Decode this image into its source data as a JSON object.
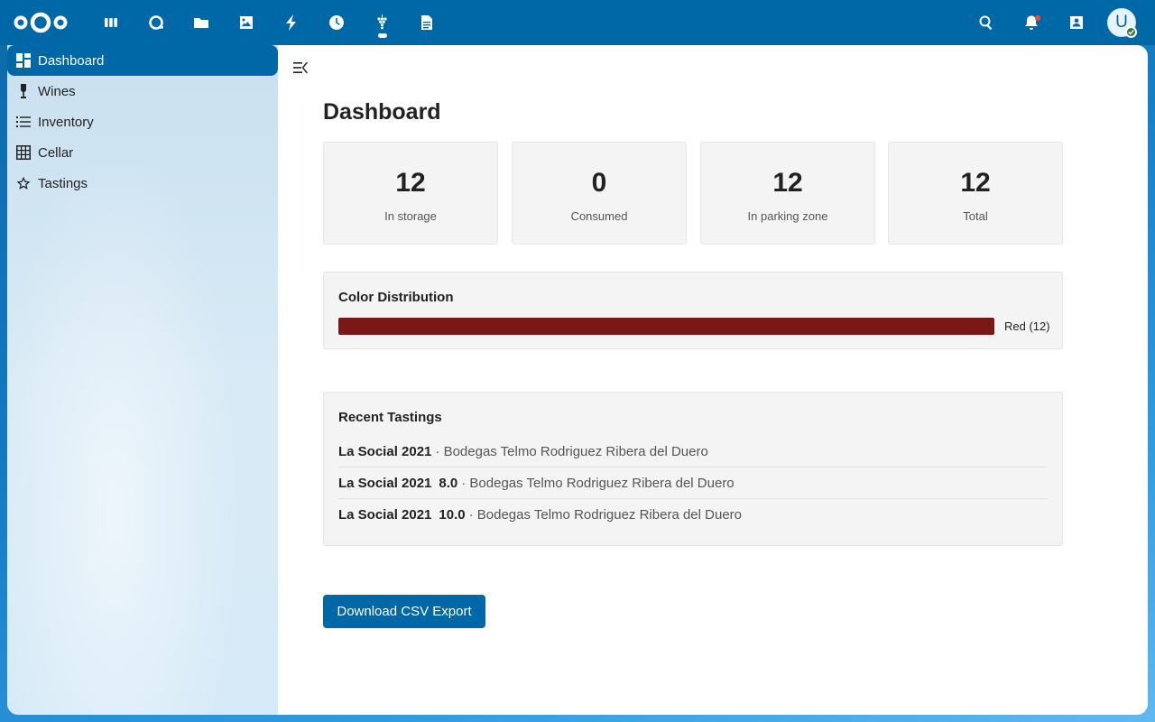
{
  "header": {
    "apps": [
      {
        "name": "dashboard-app",
        "icon": "apps-grid-icon"
      },
      {
        "name": "search-app",
        "icon": "circle-search-icon"
      },
      {
        "name": "files-app",
        "icon": "folder-icon"
      },
      {
        "name": "photos-app",
        "icon": "image-icon"
      },
      {
        "name": "activity-app",
        "icon": "lightning-icon"
      },
      {
        "name": "clock-app",
        "icon": "clock-icon"
      },
      {
        "name": "wine-app",
        "icon": "grapes-icon"
      },
      {
        "name": "notes-app",
        "icon": "document-icon"
      }
    ],
    "active_app": "wine-app",
    "avatar_initial": "U"
  },
  "sidebar": {
    "items": [
      {
        "label": "Dashboard",
        "icon": "dashboard-icon",
        "active": true
      },
      {
        "label": "Wines",
        "icon": "wine-glass-icon",
        "active": false
      },
      {
        "label": "Inventory",
        "icon": "list-icon",
        "active": false
      },
      {
        "label": "Cellar",
        "icon": "grid-icon",
        "active": false
      },
      {
        "label": "Tastings",
        "icon": "star-icon",
        "active": false
      }
    ]
  },
  "main": {
    "title": "Dashboard",
    "stats": [
      {
        "value": "12",
        "label": "In storage"
      },
      {
        "value": "0",
        "label": "Consumed"
      },
      {
        "value": "12",
        "label": "In parking zone"
      },
      {
        "value": "12",
        "label": "Total"
      }
    ],
    "color_distribution": {
      "title": "Color Distribution",
      "bars": [
        {
          "label": "Red (12)",
          "fraction": 1.0,
          "color": "#7a1818"
        }
      ]
    },
    "recent_tastings": {
      "title": "Recent Tastings",
      "items": [
        {
          "wine": "La Social 2021",
          "score": "",
          "producer": "· Bodegas Telmo Rodriguez Ribera del Duero"
        },
        {
          "wine": "La Social 2021",
          "score": "8.0",
          "producer": "· Bodegas Telmo Rodriguez Ribera del Duero"
        },
        {
          "wine": "La Social 2021",
          "score": "10.0",
          "producer": "· Bodegas Telmo Rodriguez Ribera del Duero"
        }
      ]
    },
    "export_button": "Download CSV Export"
  },
  "colors": {
    "primary": "#0068a6",
    "bar_red": "#7a1818"
  }
}
